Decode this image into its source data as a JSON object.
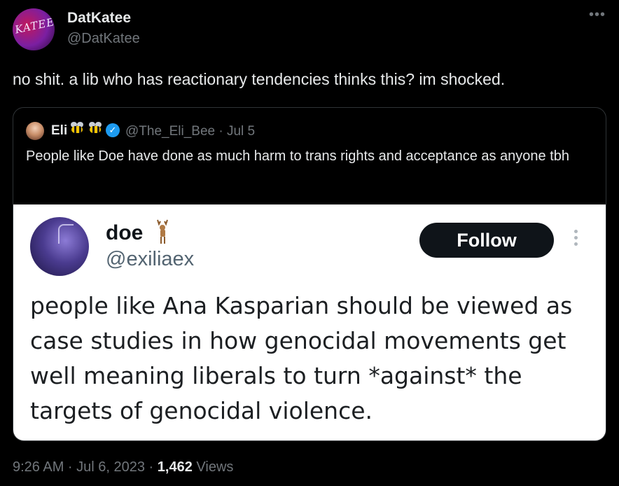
{
  "author": {
    "avatar_text": "KATEE",
    "display_name": "DatKatee",
    "handle": "@DatKatee"
  },
  "more_menu": "•••",
  "tweet_text": "no shit. a lib who has reactionary tendencies thinks this? im shocked.",
  "quote": {
    "display_name": "Eli",
    "emoji": [
      "bee",
      "bee"
    ],
    "verified_icon": "verified-badge",
    "handle_date": "@The_Eli_Bee · Jul 5",
    "text": "People like Doe have done as much harm to trans rights and acceptance as anyone tbh"
  },
  "embedded": {
    "display_name": "doe",
    "name_icon": "deer",
    "handle": "@exiliaex",
    "follow_label": "Follow",
    "text": "people like Ana Kasparian should be viewed as case studies in how genocidal movements get well meaning liberals to turn *against* the targets of genocidal violence."
  },
  "meta": {
    "time_date": "9:26 AM · Jul 6, 2023 · ",
    "views_count": "1,462",
    "views_label": " Views"
  },
  "colors": {
    "background": "#000000",
    "text_primary": "#e7e9ea",
    "text_secondary": "#71767b",
    "verified": "#1d9bf0",
    "follow_button": "#0f1419"
  }
}
